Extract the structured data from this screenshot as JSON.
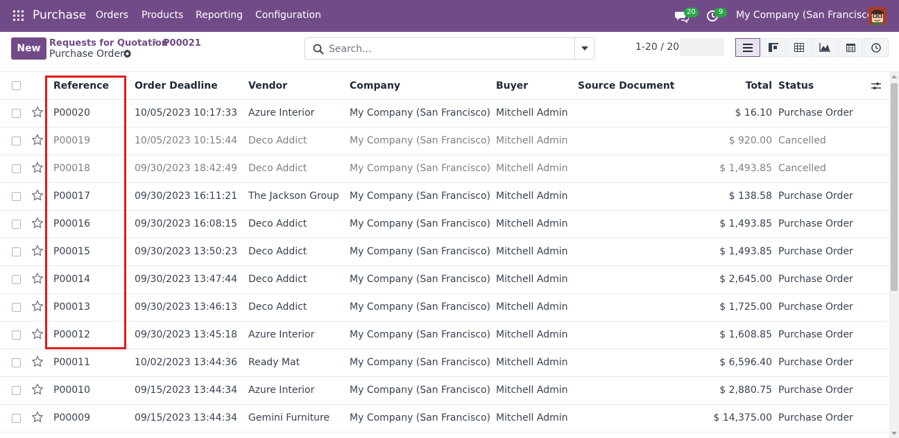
{
  "navbar": {
    "brand": "Purchase",
    "menu": [
      "Orders",
      "Products",
      "Reporting",
      "Configuration"
    ],
    "messages_badge": "20",
    "activities_badge": "9",
    "company": "My Company (San Francisco)",
    "color": "#714b87"
  },
  "control_panel": {
    "new_label": "New",
    "breadcrumb_parent": "Requests for Quotation",
    "breadcrumb_current": "P00021",
    "breadcrumb_separator": "/",
    "page_title": "Purchase Order",
    "search_placeholder": "Search...",
    "pager": "1-20 / 20",
    "views": [
      "list-icon",
      "kanban-icon",
      "pivot-icon",
      "graph-icon",
      "calendar-icon",
      "activity-icon"
    ]
  },
  "table": {
    "headers": {
      "reference": "Reference",
      "deadline": "Order Deadline",
      "vendor": "Vendor",
      "company": "Company",
      "buyer": "Buyer",
      "source": "Source Document",
      "total": "Total",
      "status": "Status"
    },
    "rows": [
      {
        "reference": "P00020",
        "deadline": "10/05/2023 10:17:33",
        "vendor": "Azure Interior",
        "company": "My Company (San Francisco)",
        "buyer": "Mitchell Admin",
        "source": "",
        "total": "$ 16.10",
        "status": "Purchase Order"
      },
      {
        "reference": "P00019",
        "deadline": "10/05/2023 10:15:44",
        "vendor": "Deco Addict",
        "company": "My Company (San Francisco)",
        "buyer": "Mitchell Admin",
        "source": "",
        "total": "$ 920.00",
        "status": "Cancelled"
      },
      {
        "reference": "P00018",
        "deadline": "09/30/2023 18:42:49",
        "vendor": "Deco Addict",
        "company": "My Company (San Francisco)",
        "buyer": "Mitchell Admin",
        "source": "",
        "total": "$ 1,493.85",
        "status": "Cancelled"
      },
      {
        "reference": "P00017",
        "deadline": "09/30/2023 16:11:21",
        "vendor": "The Jackson Group",
        "company": "My Company (San Francisco)",
        "buyer": "Mitchell Admin",
        "source": "",
        "total": "$ 138.58",
        "status": "Purchase Order"
      },
      {
        "reference": "P00016",
        "deadline": "09/30/2023 16:08:15",
        "vendor": "Deco Addict",
        "company": "My Company (San Francisco)",
        "buyer": "Mitchell Admin",
        "source": "",
        "total": "$ 1,493.85",
        "status": "Purchase Order"
      },
      {
        "reference": "P00015",
        "deadline": "09/30/2023 13:50:23",
        "vendor": "Deco Addict",
        "company": "My Company (San Francisco)",
        "buyer": "Mitchell Admin",
        "source": "",
        "total": "$ 1,493.85",
        "status": "Purchase Order"
      },
      {
        "reference": "P00014",
        "deadline": "09/30/2023 13:47:44",
        "vendor": "Deco Addict",
        "company": "My Company (San Francisco)",
        "buyer": "Mitchell Admin",
        "source": "",
        "total": "$ 2,645.00",
        "status": "Purchase Order"
      },
      {
        "reference": "P00013",
        "deadline": "09/30/2023 13:46:13",
        "vendor": "Deco Addict",
        "company": "My Company (San Francisco)",
        "buyer": "Mitchell Admin",
        "source": "",
        "total": "$ 1,725.00",
        "status": "Purchase Order"
      },
      {
        "reference": "P00012",
        "deadline": "09/30/2023 13:45:18",
        "vendor": "Azure Interior",
        "company": "My Company (San Francisco)",
        "buyer": "Mitchell Admin",
        "source": "",
        "total": "$ 1,608.85",
        "status": "Purchase Order"
      },
      {
        "reference": "P00011",
        "deadline": "10/02/2023 13:44:36",
        "vendor": "Ready Mat",
        "company": "My Company (San Francisco)",
        "buyer": "Mitchell Admin",
        "source": "",
        "total": "$ 6,596.40",
        "status": "Purchase Order"
      },
      {
        "reference": "P00010",
        "deadline": "09/15/2023 13:44:34",
        "vendor": "Azure Interior",
        "company": "My Company (San Francisco)",
        "buyer": "Mitchell Admin",
        "source": "",
        "total": "$ 2,880.75",
        "status": "Purchase Order"
      },
      {
        "reference": "P00009",
        "deadline": "09/15/2023 13:44:34",
        "vendor": "Gemini Furniture",
        "company": "My Company (San Francisco)",
        "buyer": "Mitchell Admin",
        "source": "",
        "total": "$ 14,375.00",
        "status": "Purchase Order"
      }
    ]
  },
  "highlight_color": "#e01a1a"
}
